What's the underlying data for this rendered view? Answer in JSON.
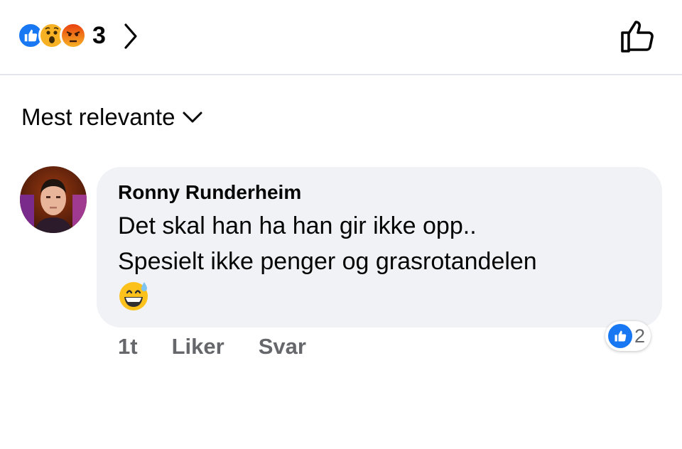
{
  "reactions": {
    "types": [
      "like-icon",
      "wow-icon",
      "angry-icon"
    ],
    "count": "3",
    "colors": {
      "like": "#1877f2",
      "wow": "#f7b125",
      "angry": "#e9710f"
    }
  },
  "sort": {
    "label": "Mest relevante"
  },
  "comment": {
    "author": "Ronny Runderheim",
    "lines": [
      "Det skal han ha han gir ikke opp..",
      "Spesielt ikke penger og grasrotandelen"
    ],
    "emoji": "grinning-sweat-emoji",
    "time": "1t",
    "like_label": "Liker",
    "reply_label": "Svar",
    "like_count": "2"
  }
}
